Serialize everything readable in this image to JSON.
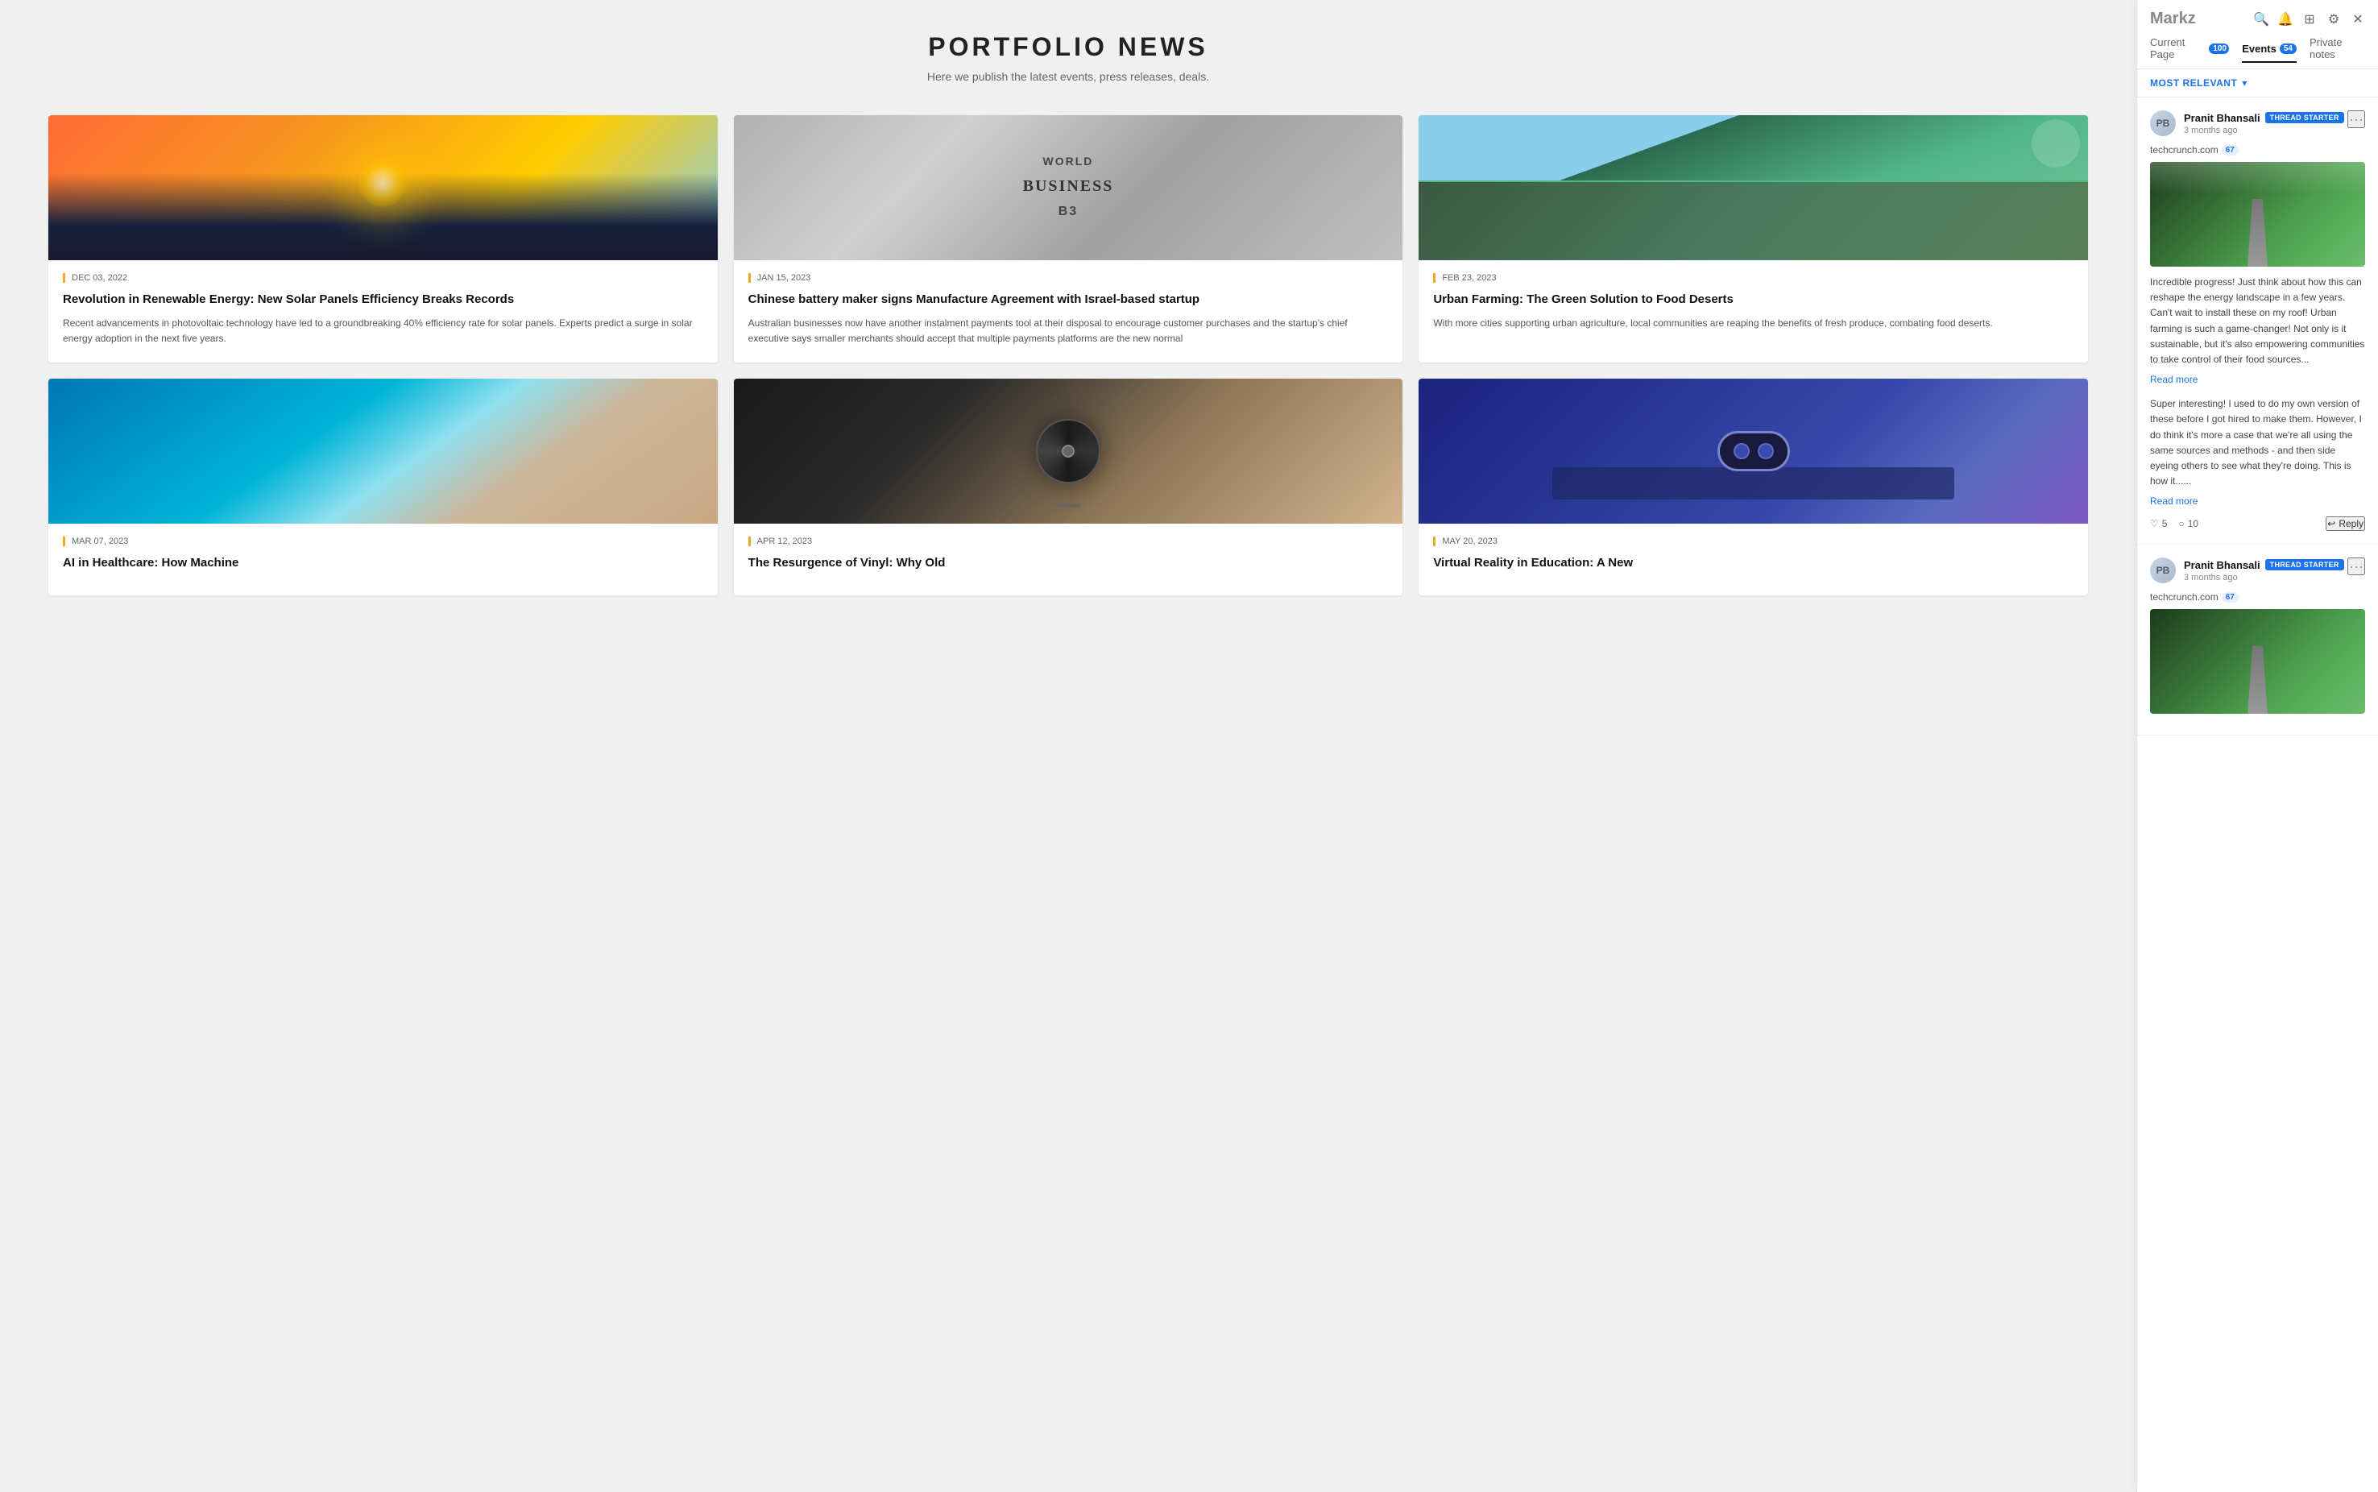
{
  "page": {
    "title": "PORTFOLIO NEWS",
    "subtitle": "Here we publish the latest events, press releases, deals."
  },
  "sidebar": {
    "logo": "Markz",
    "tabs": [
      {
        "label": "Current Page",
        "badge": "100",
        "active": false
      },
      {
        "label": "Events",
        "badge": "54",
        "active": true
      },
      {
        "label": "Private notes",
        "badge": null,
        "active": false
      }
    ],
    "filter": {
      "label": "MOST RELEVANT",
      "icon": "chevron-down"
    },
    "icons": [
      "search",
      "bell",
      "grid",
      "gear",
      "close"
    ]
  },
  "articles": [
    {
      "date": "DEC 03, 2022",
      "title": "Revolution in Renewable Energy: New Solar Panels Efficiency Breaks Records",
      "excerpt": "Recent advancements in photovoltaic technology have led to a groundbreaking 40% efficiency rate for solar panels. Experts predict a surge in solar energy adoption in the next five years.",
      "image_type": "solar"
    },
    {
      "date": "JAN 15, 2023",
      "title": "Chinese battery maker signs Manufacture Agreement with Israel-based startup",
      "excerpt": "Australian businesses now have another instalment payments tool at their disposal to encourage customer purchases and the startup's chief executive says smaller merchants should accept that multiple payments platforms are the new normal",
      "image_type": "newspaper"
    },
    {
      "date": "FEB 23, 2023",
      "title": "Urban Farming: The Green Solution to Food Deserts",
      "excerpt": "With more cities supporting urban agriculture, local communities are reaping the benefits of fresh produce, combating food deserts.",
      "image_type": "farming"
    },
    {
      "date": "MAR 07, 2023",
      "title": "AI in Healthcare: How Machine",
      "excerpt": "",
      "image_type": "ocean"
    },
    {
      "date": "APR 12, 2023",
      "title": "The Resurgence of Vinyl: Why Old",
      "excerpt": "",
      "image_type": "vinyl"
    },
    {
      "date": "MAY 20, 2023",
      "title": "Virtual Reality in Education: A New",
      "excerpt": "",
      "image_type": "vr"
    }
  ],
  "comments": [
    {
      "username": "Pranit Bhansali",
      "badge": "THREAD STARTER",
      "time": "3 months ago",
      "source": "techcrunch.com",
      "source_count": "67",
      "comment_text": "Incredible progress! Just think about how this can reshape the energy landscape in a few years. Can't wait to install these on my roof! Urban farming is such a game-changer! Not only is it sustainable, but it's also empowering communities to take control of their food sources...",
      "has_image": true,
      "read_more": true,
      "standalone_text": "Super interesting! I used to do my own version of these before I got hired to make them. However, I do think it's more a case that we're all using the same sources and methods - and then side eyeing others to see what they're doing. This is how it......",
      "standalone_read_more": true,
      "likes": 5,
      "comments_count": 10,
      "show_actions": true
    },
    {
      "username": "Pranit Bhansali",
      "badge": "THREAD STARTER",
      "time": "3 months ago",
      "source": "techcrunch.com",
      "source_count": "67",
      "has_image": true,
      "show_actions": false
    }
  ]
}
